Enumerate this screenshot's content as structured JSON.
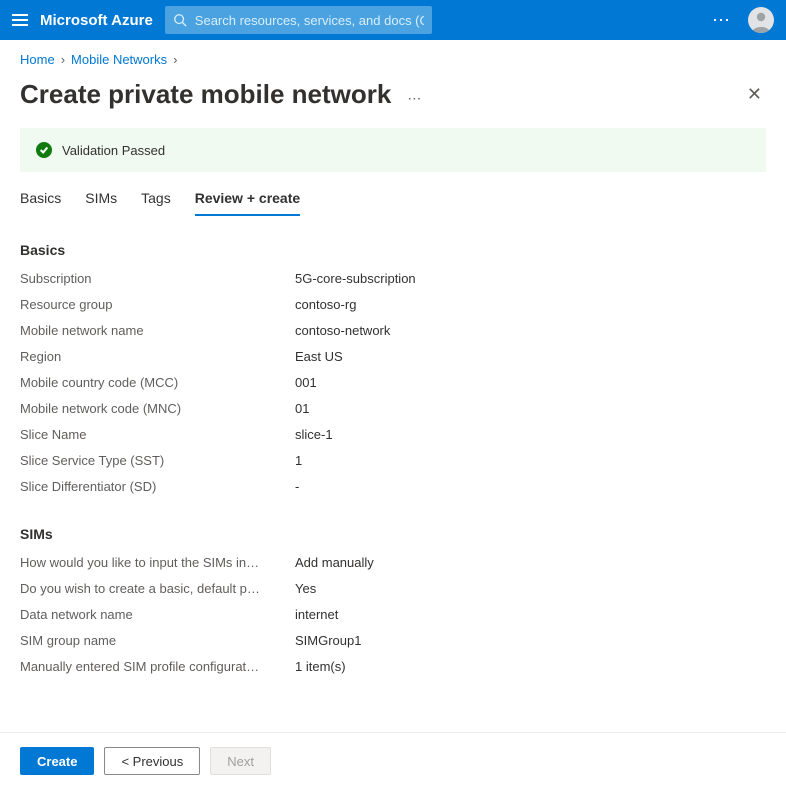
{
  "header": {
    "brand": "Microsoft Azure",
    "search_placeholder": "Search resources, services, and docs (G+/)"
  },
  "breadcrumb": {
    "items": [
      "Home",
      "Mobile Networks"
    ]
  },
  "page": {
    "title": "Create private mobile network"
  },
  "banner": {
    "text": "Validation Passed"
  },
  "tabs": {
    "items": [
      "Basics",
      "SIMs",
      "Tags",
      "Review + create"
    ],
    "active_index": 3
  },
  "sections": {
    "basics": {
      "heading": "Basics",
      "rows": [
        {
          "label": "Subscription",
          "value": "5G-core-subscription"
        },
        {
          "label": "Resource group",
          "value": "contoso-rg"
        },
        {
          "label": "Mobile network name",
          "value": "contoso-network"
        },
        {
          "label": "Region",
          "value": "East US"
        },
        {
          "label": "Mobile country code (MCC)",
          "value": "001"
        },
        {
          "label": "Mobile network code (MNC)",
          "value": "01"
        },
        {
          "label": "Slice Name",
          "value": "slice-1"
        },
        {
          "label": "Slice Service Type (SST)",
          "value": "1"
        },
        {
          "label": "Slice Differentiator (SD)",
          "value": "-"
        }
      ]
    },
    "sims": {
      "heading": "SIMs",
      "rows": [
        {
          "label": "How would you like to input the SIMs in…",
          "value": "Add manually"
        },
        {
          "label": "Do you wish to create a basic, default p…",
          "value": "Yes"
        },
        {
          "label": "Data network name",
          "value": "internet"
        },
        {
          "label": "SIM group name",
          "value": "SIMGroup1"
        },
        {
          "label": "Manually entered SIM profile configurat…",
          "value": "1 item(s)"
        }
      ]
    }
  },
  "footer": {
    "create": "Create",
    "previous": "< Previous",
    "next": "Next"
  }
}
